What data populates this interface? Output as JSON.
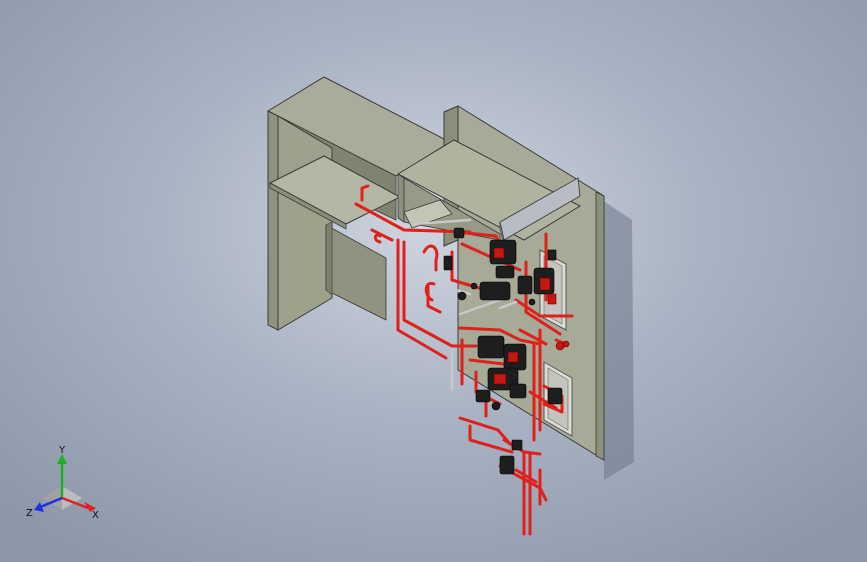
{
  "viewport": {
    "background_top": "#cfd5e0",
    "background_bottom": "#8c96a8",
    "panel_color": "#a9ad98",
    "pipe_color": "#e0201a",
    "valve_color": "#1e1e1e"
  },
  "triad": {
    "x_label": "X",
    "y_label": "Y",
    "z_label": "Z",
    "x_color": "#e02020",
    "y_color": "#20b020",
    "z_color": "#2030e0"
  }
}
